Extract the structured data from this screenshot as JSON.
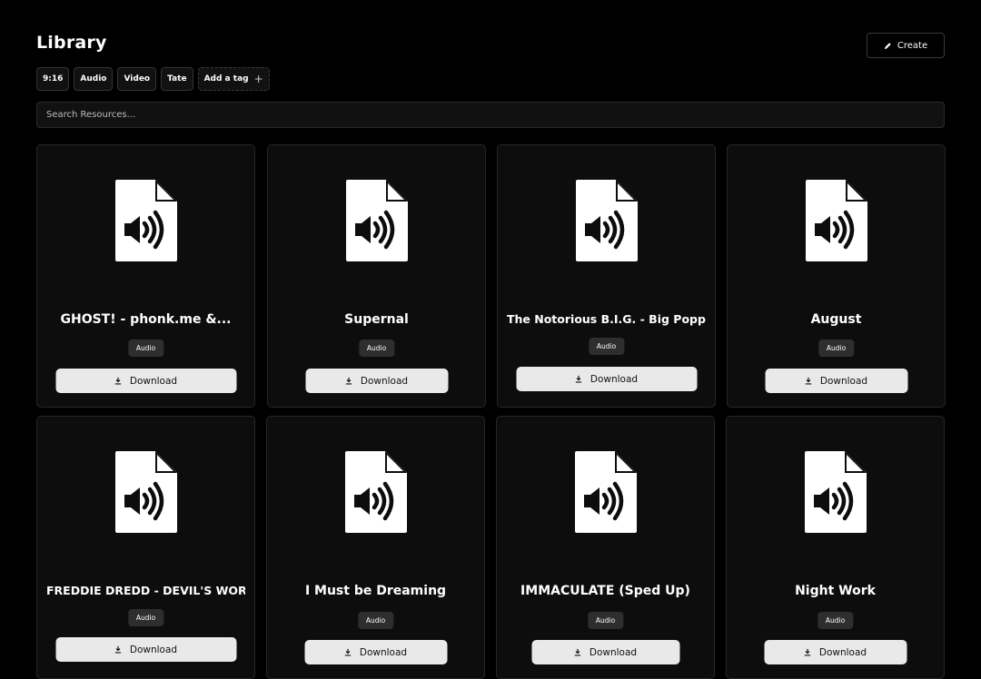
{
  "header": {
    "title": "Library",
    "create_label": "Create"
  },
  "tags": [
    "9:16",
    "Audio",
    "Video",
    "Tate"
  ],
  "add_tag_label": "Add a tag",
  "search": {
    "placeholder": "Search Resources..."
  },
  "cards": [
    {
      "title": "GHOST! - phonk.me &...",
      "badge": "Audio",
      "download_label": "Download"
    },
    {
      "title": "Supernal",
      "badge": "Audio",
      "download_label": "Download"
    },
    {
      "title": "The Notorious B.I.G. - Big Poppa...",
      "badge": "Audio",
      "download_label": "Download"
    },
    {
      "title": "August",
      "badge": "Audio",
      "download_label": "Download"
    },
    {
      "title": "FREDDIE DREDD - DEVIL'S WORK..",
      "badge": "Audio",
      "download_label": "Download"
    },
    {
      "title": "I Must be Dreaming",
      "badge": "Audio",
      "download_label": "Download"
    },
    {
      "title": "IMMACULATE (Sped Up)",
      "badge": "Audio",
      "download_label": "Download"
    },
    {
      "title": "Night Work",
      "badge": "Audio",
      "download_label": "Download"
    }
  ],
  "icons": {
    "card": "audio-file-icon",
    "download": "download-icon",
    "create": "pencil-icon",
    "add": "plus-icon"
  },
  "colors": {
    "background": "#000000",
    "card": "#0d0d0d",
    "button": "#e9e9e9",
    "badge": "#2e2e2e"
  }
}
